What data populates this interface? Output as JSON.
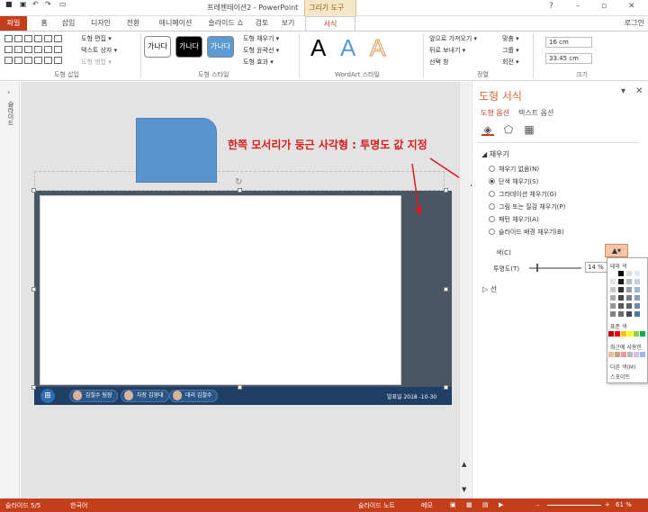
{
  "titlebar": {
    "title": "프레젠테이션2 - PowerPoint",
    "context_group": "그리기 도구",
    "minimize": "–",
    "maximize": "▫",
    "close": "✕",
    "help": "?"
  },
  "tabs": [
    "파일",
    "홈",
    "삽입",
    "디자인",
    "전환",
    "애니메이션",
    "슬라이드 쇼",
    "검토",
    "보기",
    "서식"
  ],
  "login": "로그인",
  "ribbon": {
    "insert_shapes": {
      "edit_shape": "도형 편집 ▾",
      "text_box": "텍스트 상자 ▾",
      "merge_shapes": "도형 병합 ▾",
      "label": "도형 삽입"
    },
    "shape_styles": {
      "swatches": [
        "가나다",
        "가나다",
        "가나다"
      ],
      "fill": "도형 채우기 ▾",
      "outline": "도형 윤곽선 ▾",
      "effects": "도형 효과 ▾",
      "label": "도형 스타일"
    },
    "wordart": {
      "label": "WordArt 스타일"
    },
    "arrange": {
      "bring_forward": "앞으로 가져오기 ▾",
      "send_backward": "뒤로 보내기 ▾",
      "selection_pane": "선택 창",
      "align": "맞춤 ▾",
      "group": "그룹 ▾",
      "rotate": "회전 ▾",
      "label": "정렬"
    },
    "size": {
      "height": "16 cm",
      "width": "33.45 cm",
      "label": "크기"
    }
  },
  "left_panel": {
    "label": "슬라이드"
  },
  "slide": {
    "annotation": "한쪽 모서리가 둥근 사각형 : 투명도 값 지정",
    "taskbar_buttons": [
      "김철수 팀장",
      "차장 김영대",
      "대리 김철수"
    ],
    "release": "발표일 2018 -10-30"
  },
  "pane": {
    "title": "도형 서식",
    "tab_shape": "도형 옵션",
    "tab_text": "텍스트 옵션",
    "fill_header": "◢ 채우기",
    "fill_options": [
      {
        "label": "채우기 없음(N)",
        "selected": false
      },
      {
        "label": "단색 채우기(S)",
        "selected": true
      },
      {
        "label": "그라데이션 채우기(G)",
        "selected": false
      },
      {
        "label": "그림 또는 질감 채우기(P)",
        "selected": false
      },
      {
        "label": "패턴 채우기(A)",
        "selected": false
      },
      {
        "label": "슬라이드 배경 채우기(B)",
        "selected": false
      }
    ],
    "color_label": "색(C)",
    "transparency_label": "투명도(T)",
    "transparency_value": "14 %",
    "transparency_level": 0.14,
    "line_header": "▷ 선"
  },
  "color_popup": {
    "theme": "테마 색",
    "standard": "표준 색",
    "recent": "최근에 사용한",
    "more": "다른 색(M)",
    "eyedropper": "스포이트",
    "theme_colors": [
      "#ffffff",
      "#000000",
      "#44546a",
      "#5b9bd5"
    ],
    "standard_colors": [
      "#c00000",
      "#ff0000",
      "#ffc000",
      "#ffff00",
      "#92d050",
      "#00b050"
    ],
    "recent_colors": [
      "#e8c0a0",
      "#c9a27e",
      "#e89a9a",
      "#b9b9b9",
      "#d9b9e9",
      "#9ab9e9"
    ]
  },
  "statusbar": {
    "slide": "슬라이드 5/5",
    "lang": "한국어",
    "notes": "슬라이드 노트",
    "memo": "메모",
    "zoom": "61 %"
  },
  "colors": {
    "accent": "#c43e1c",
    "slide_bg": "#4a5664",
    "shape_fill": "#5a93cf",
    "annotation": "#d81b1b"
  }
}
